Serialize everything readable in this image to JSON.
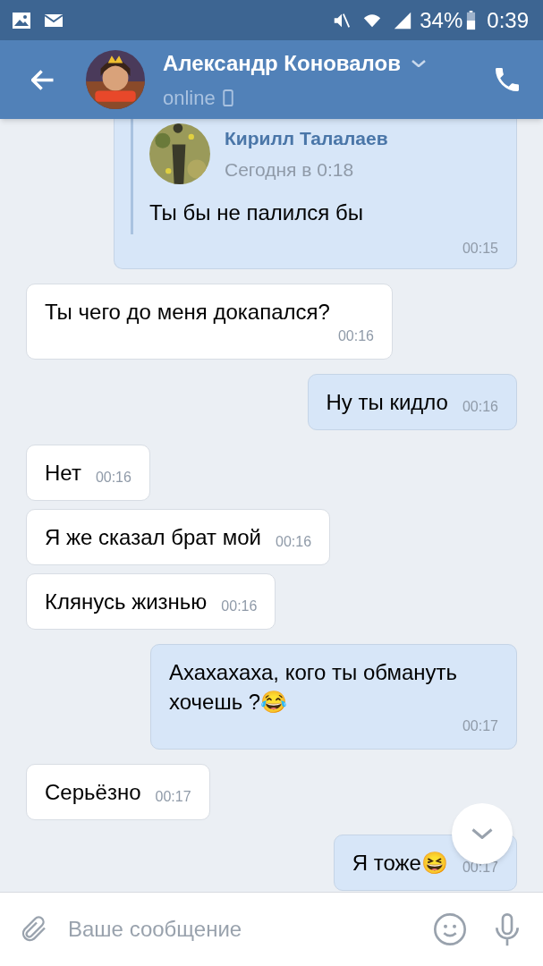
{
  "status_bar": {
    "battery": "34%",
    "time": "0:39"
  },
  "header": {
    "name": "Александр Коновалов",
    "status": "online"
  },
  "messages": [
    {
      "kind": "outgoing",
      "forward": {
        "author": "Кирилл Талалаев",
        "date": "Сегодня в 0:18",
        "text": "Ты бы не палился бы"
      },
      "time": "00:15"
    },
    {
      "kind": "incoming",
      "text": "Ты чего до меня докапался?",
      "time": "00:16"
    },
    {
      "kind": "outgoing",
      "text": "Ну ты кидло",
      "time": "00:16"
    },
    {
      "kind": "incoming",
      "text": "Нет",
      "time": "00:16"
    },
    {
      "kind": "incoming",
      "text": "Я же сказал брат мой",
      "time": "00:16"
    },
    {
      "kind": "incoming",
      "text": "Клянусь жизнью",
      "time": "00:16"
    },
    {
      "kind": "outgoing",
      "text": "Ахахахаха, кого ты обмануть хочешь ?😂",
      "time": "00:17"
    },
    {
      "kind": "incoming",
      "text": "Серьёзно",
      "time": "00:17"
    },
    {
      "kind": "outgoing",
      "text": "Я тоже😆",
      "time": "00:17"
    }
  ],
  "composer": {
    "placeholder": "Ваше сообщение"
  }
}
